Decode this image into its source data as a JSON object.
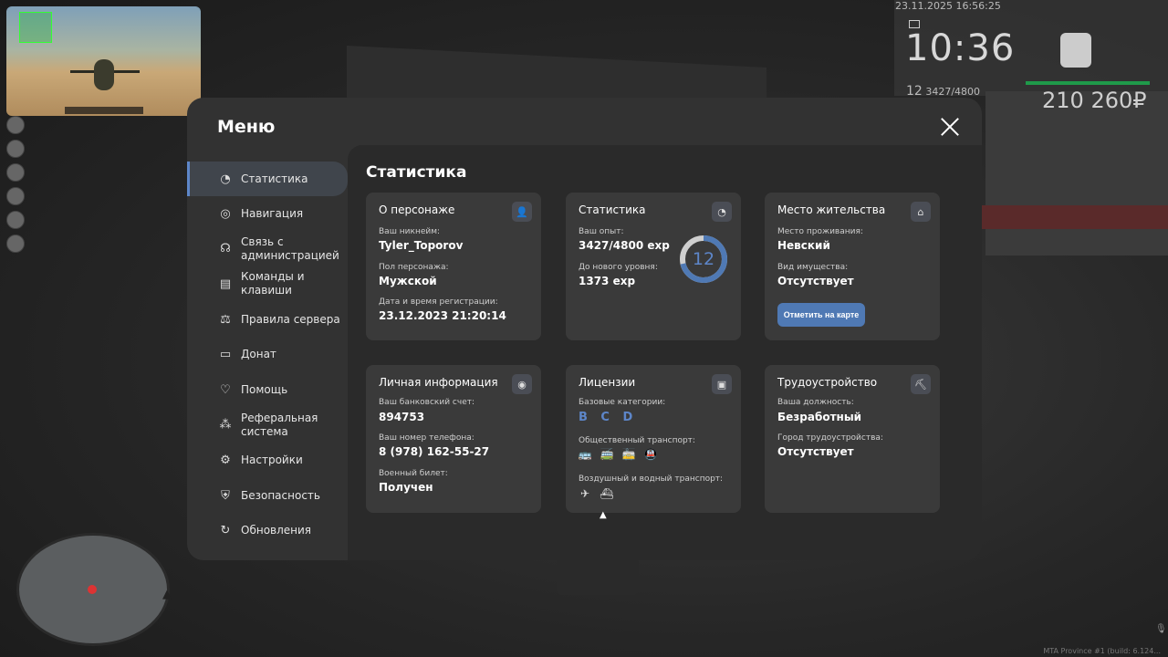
{
  "hud": {
    "datetime": "23.11.2025 16:56:25",
    "time": "10:36",
    "level": "12",
    "exp": "3427/4800",
    "money": "210 260₽",
    "build": "MTA Province #1 (build: 6.124..."
  },
  "menu": {
    "title": "Меню",
    "nav": [
      {
        "label": "Статистика",
        "icon": "pie-chart-icon"
      },
      {
        "label": "Навигация",
        "icon": "compass-icon"
      },
      {
        "label": "Связь с администрацией",
        "icon": "headset-icon"
      },
      {
        "label": "Команды и клавиши",
        "icon": "document-icon"
      },
      {
        "label": "Правила сервера",
        "icon": "scales-icon"
      },
      {
        "label": "Донат",
        "icon": "wallet-icon"
      },
      {
        "label": "Помощь",
        "icon": "handshake-icon"
      },
      {
        "label": "Реферальная система",
        "icon": "network-icon"
      },
      {
        "label": "Настройки",
        "icon": "gear-icon"
      },
      {
        "label": "Безопасность",
        "icon": "shield-icon"
      },
      {
        "label": "Обновления",
        "icon": "refresh-check-icon"
      }
    ]
  },
  "stats": {
    "title": "Статистика",
    "character": {
      "title": "О персонаже",
      "nick_label": "Ваш никнейм:",
      "nick": "Tyler_Toporov",
      "gender_label": "Пол персонажа:",
      "gender": "Мужской",
      "reg_label": "Дата и время регистрации:",
      "reg": "23.12.2023 21:20:14"
    },
    "statistics": {
      "title": "Статистика",
      "exp_label": "Ваш опыт:",
      "exp": "3427/4800 exp",
      "next_label": "До нового уровня:",
      "next": "1373 exp",
      "level": "12",
      "progress": 0.714
    },
    "residence": {
      "title": "Место жительства",
      "place_label": "Место проживания:",
      "place": "Невский",
      "property_label": "Вид имущества:",
      "property": "Отсутствует",
      "map_button": "Отметить на карте"
    },
    "personal": {
      "title": "Личная информация",
      "bank_label": "Ваш банковский счет:",
      "bank": "894753",
      "phone_label": "Ваш номер телефона:",
      "phone": "8 (978) 162-55-27",
      "military_label": "Военный билет:",
      "military": "Получен"
    },
    "licenses": {
      "title": "Лицензии",
      "base_label": "Базовые категории:",
      "base": "B C D",
      "public_label": "Общественный транспорт:",
      "air_label": "Воздушный и водный транспорт:"
    },
    "employment": {
      "title": "Трудоустройство",
      "position_label": "Ваша должность:",
      "position": "Безработный",
      "city_label": "Город трудоустройства:",
      "city": "Отсутствует"
    }
  }
}
